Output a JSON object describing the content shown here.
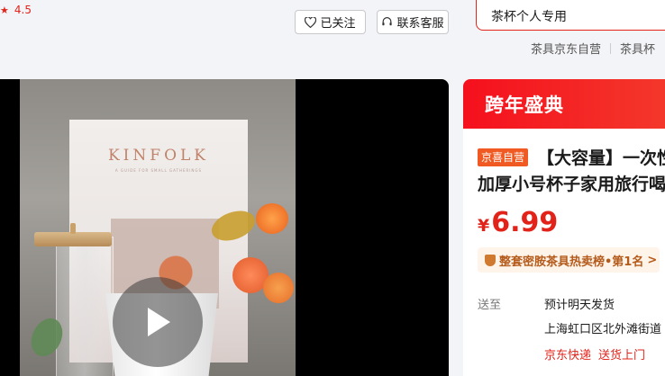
{
  "header": {
    "rating": "4.5",
    "follow_label": "已关注",
    "service_label": "联系客服",
    "search_value": "茶杯个人专用",
    "crumbs": [
      "茶具京东自营",
      "茶具杯"
    ]
  },
  "video": {
    "magazine_title": "KINFOLK",
    "magazine_subtitle": "A GUIDE FOR SMALL GATHERINGS"
  },
  "product": {
    "promo_title": "跨年盛典",
    "self_run_badge": "京喜自营",
    "title_line1": "【大容量】一次性",
    "title_line2": "加厚小号杯子家用旅行喝",
    "currency": "¥",
    "price": "6.99",
    "rank_text": "整套密胺茶具热卖榜•第1名",
    "rank_arrow": ">",
    "delivery_label": "送至",
    "delivery_estimate": "预计明天发货",
    "delivery_address": "上海虹口区北外滩街道",
    "express": "京东快递",
    "door_service": "送货上门"
  }
}
